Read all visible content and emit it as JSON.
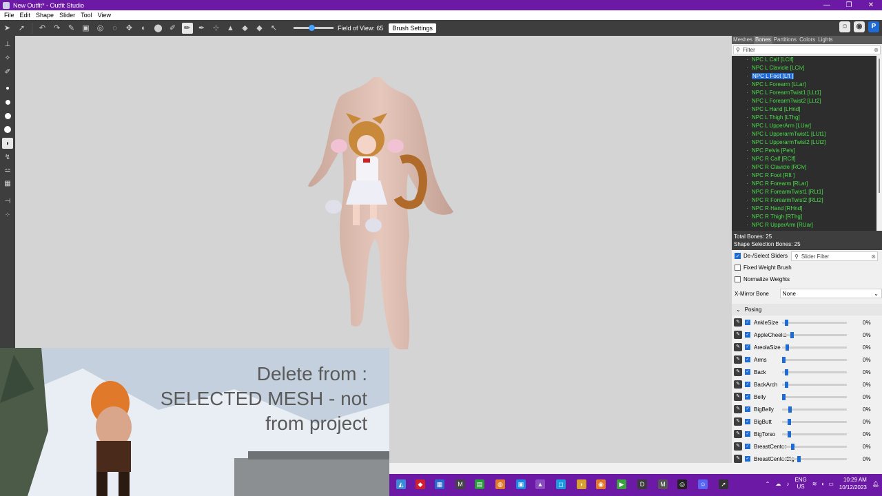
{
  "window": {
    "title": "New Outfit* - Outfit Studio",
    "controls": [
      "—",
      "❐",
      "✕"
    ]
  },
  "menu": [
    "File",
    "Edit",
    "Shape",
    "Slider",
    "Tool",
    "View"
  ],
  "toolbar": {
    "fov_label": "Field of View: 65",
    "fov_value": 65,
    "brush_settings": "Brush Settings"
  },
  "right_tabs": [
    "Meshes",
    "Bones",
    "Partitions",
    "Colors",
    "Lights"
  ],
  "bone_filter_placeholder": "Filter",
  "bones": [
    "NPC L Calf [LClf]",
    "NPC L Clavicle [LClv]",
    "NPC L Foot [Lft ]",
    "NPC L Forearm [LLar]",
    "NPC L ForearmTwist1 [LLt1]",
    "NPC L ForearmTwist2 [LLt2]",
    "NPC L Hand [LHnd]",
    "NPC L Thigh [LThg]",
    "NPC L UpperArm [LUar]",
    "NPC L UpperarmTwist1 [LUt1]",
    "NPC L UpperarmTwist2 [LUt2]",
    "NPC Pelvis [Pelv]",
    "NPC R Calf [RClf]",
    "NPC R Clavicle [RClv]",
    "NPC R Foot [Rft ]",
    "NPC R Forearm [RLar]",
    "NPC R ForearmTwist1 [RLt1]",
    "NPC R ForearmTwist2 [RLt2]",
    "NPC R Hand [RHnd]",
    "NPC R Thigh [RThg]",
    "NPC R UpperArm [RUar]"
  ],
  "selected_bone": "NPC L Foot [Lft ]",
  "bone_info": {
    "total": "Total Bones: 25",
    "shape_selection": "Shape Selection Bones: 25"
  },
  "options": {
    "deselect_sliders": "De-/Select Sliders",
    "slider_filter_placeholder": "Slider Filter",
    "fixed_weight_brush": "Fixed Weight Brush",
    "normalize_weights": "Normalize Weights",
    "x_mirror_label": "X-Mirror Bone",
    "x_mirror_value": "None"
  },
  "posing_label": "Posing",
  "sliders": [
    {
      "name": "AnkleSize",
      "value": "0%",
      "level": 0.04
    },
    {
      "name": "AppleCheeks",
      "value": "0%",
      "level": 0.14
    },
    {
      "name": "AreolaSize",
      "value": "0%",
      "level": 0.06
    },
    {
      "name": "Arms",
      "value": "0%",
      "level": 0.0
    },
    {
      "name": "Back",
      "value": "0%",
      "level": 0.05
    },
    {
      "name": "BackArch",
      "value": "0%",
      "level": 0.04
    },
    {
      "name": "Belly",
      "value": "0%",
      "level": 0.0
    },
    {
      "name": "BigBelly",
      "value": "0%",
      "level": 0.1
    },
    {
      "name": "BigButt",
      "value": "0%",
      "level": 0.09
    },
    {
      "name": "BigTorso",
      "value": "0%",
      "level": 0.09
    },
    {
      "name": "BreastCenter",
      "value": "0%",
      "level": 0.15
    },
    {
      "name": "BreastCenterBig",
      "value": "0%",
      "level": 0.25
    }
  ],
  "overlay_text": [
    "Delete from :",
    "SELECTED MESH - not",
    "from project"
  ],
  "tray": {
    "lang1": "ENG",
    "lang2": "US",
    "time": "10:29 AM",
    "date": "10/12/2023"
  },
  "colors": {
    "titlebar": "#6c1aa6",
    "bone_text": "#48e048",
    "accent": "#1f6bd6"
  }
}
